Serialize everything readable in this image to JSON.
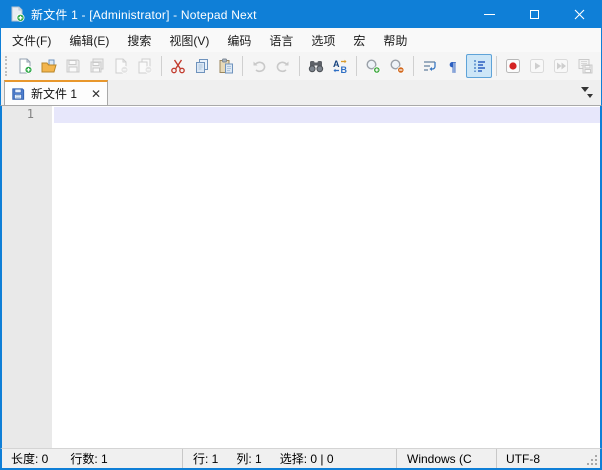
{
  "window": {
    "title": "新文件 1 - [Administrator] - Notepad Next",
    "accent_color": "#0f7fd7",
    "controls": [
      "minimize-icon",
      "maximize-icon",
      "close-icon"
    ]
  },
  "menu": {
    "items": [
      {
        "label": "文件(F)"
      },
      {
        "label": "编辑(E)"
      },
      {
        "label": "搜索"
      },
      {
        "label": "视图(V)"
      },
      {
        "label": "编码"
      },
      {
        "label": "语言"
      },
      {
        "label": "选项"
      },
      {
        "label": "宏"
      },
      {
        "label": "帮助"
      }
    ]
  },
  "toolbar": {
    "icons": [
      {
        "name": "new-file-icon",
        "enabled": true
      },
      {
        "name": "open-file-icon",
        "enabled": true
      },
      {
        "name": "save-icon",
        "enabled": false
      },
      {
        "name": "save-all-icon",
        "enabled": false
      },
      {
        "name": "close-file-icon",
        "enabled": false
      },
      {
        "name": "close-all-icon",
        "enabled": false
      },
      {
        "name": "cut-icon",
        "enabled": true
      },
      {
        "name": "copy-icon",
        "enabled": true
      },
      {
        "name": "paste-icon",
        "enabled": true
      },
      {
        "name": "undo-icon",
        "enabled": false
      },
      {
        "name": "redo-icon",
        "enabled": false
      },
      {
        "name": "find-icon",
        "enabled": true
      },
      {
        "name": "replace-icon",
        "enabled": true
      },
      {
        "name": "zoom-in-icon",
        "enabled": true
      },
      {
        "name": "zoom-out-icon",
        "enabled": true
      },
      {
        "name": "word-wrap-icon",
        "enabled": true
      },
      {
        "name": "show-all-characters-icon",
        "enabled": true
      },
      {
        "name": "indent-guide-icon",
        "enabled": true,
        "toggled": true
      },
      {
        "name": "record-macro-icon",
        "enabled": true
      },
      {
        "name": "play-macro-icon",
        "enabled": false
      },
      {
        "name": "run-macro-multiple-icon",
        "enabled": false
      },
      {
        "name": "save-macro-icon",
        "enabled": false
      }
    ],
    "accent_toggle_bg": "#cde6f7",
    "accent_toggle_border": "#5ea3d8"
  },
  "tabbar": {
    "tabs": [
      {
        "label": "新文件 1",
        "active": true,
        "close_glyph": "✕",
        "accent_top": "#e8972c"
      }
    ]
  },
  "editor": {
    "line_numbers": [
      "1"
    ],
    "content": "",
    "caret_line_color": "#e7e7fb"
  },
  "status_bar": {
    "length": "长度: 0",
    "line_count": "行数: 1",
    "line": "行: 1",
    "column": "列: 1",
    "selection": "选择: 0 | 0",
    "eol_format": "Windows (C",
    "encoding": "UTF-8"
  }
}
